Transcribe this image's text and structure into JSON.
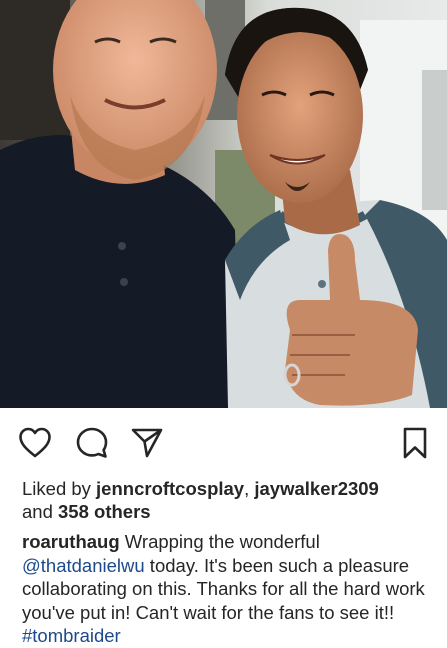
{
  "post": {
    "photo_alt": "Two men smiling, one giving a thumbs up",
    "icons": {
      "like": "heart-outline-icon",
      "comment": "speech-bubble-icon",
      "share": "paper-plane-icon",
      "save": "bookmark-icon"
    },
    "likes": {
      "prefix": "Liked by ",
      "user1": "jenncroftcosplay",
      "separator": ", ",
      "user2": "jaywalker2309",
      "and_text": "and ",
      "others": "358 others"
    },
    "caption": {
      "username": "roaruthaug",
      "text1": " Wrapping the wonderful ",
      "mention": "@thatdanielwu",
      "text2": " today. It's been such a pleasure collaborating on this. Thanks for all the hard work you've put in! Can't wait for the fans to see it!! ",
      "hashtag": "#tombraider"
    }
  },
  "colors": {
    "text": "#262626",
    "link": "#1c4a8a",
    "background": "#ffffff"
  }
}
